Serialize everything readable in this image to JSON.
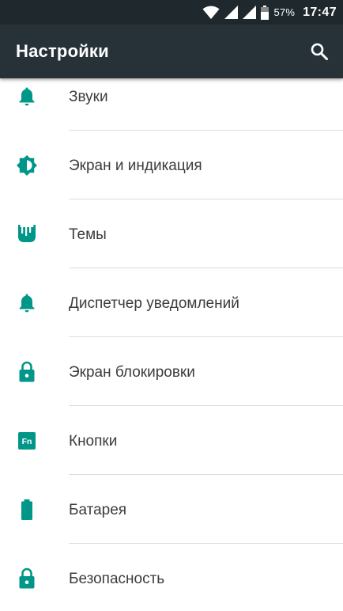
{
  "status_bar": {
    "battery_percent": "57%",
    "time": "17:47",
    "icons": [
      "wifi-icon",
      "signal-icon",
      "signal-icon",
      "battery-icon"
    ]
  },
  "toolbar": {
    "title": "Настройки",
    "search_icon": "search-icon"
  },
  "settings_items": [
    {
      "label": "Звуки",
      "icon": "bell-icon"
    },
    {
      "label": "Экран и индикация",
      "icon": "brightness-icon"
    },
    {
      "label": "Темы",
      "icon": "themes-icon"
    },
    {
      "label": "Диспетчер уведомлений",
      "icon": "bell-icon"
    },
    {
      "label": "Экран блокировки",
      "icon": "lock-icon"
    },
    {
      "label": "Кнопки",
      "icon": "fn-key-icon"
    },
    {
      "label": "Батарея",
      "icon": "battery-icon"
    },
    {
      "label": "Безопасность",
      "icon": "lock-icon"
    }
  ],
  "colors": {
    "status_bar_bg": "#1f292d",
    "toolbar_bg": "#263238",
    "accent": "#009688",
    "label_text": "#3c3c3c",
    "divider": "#dcdcdc"
  }
}
